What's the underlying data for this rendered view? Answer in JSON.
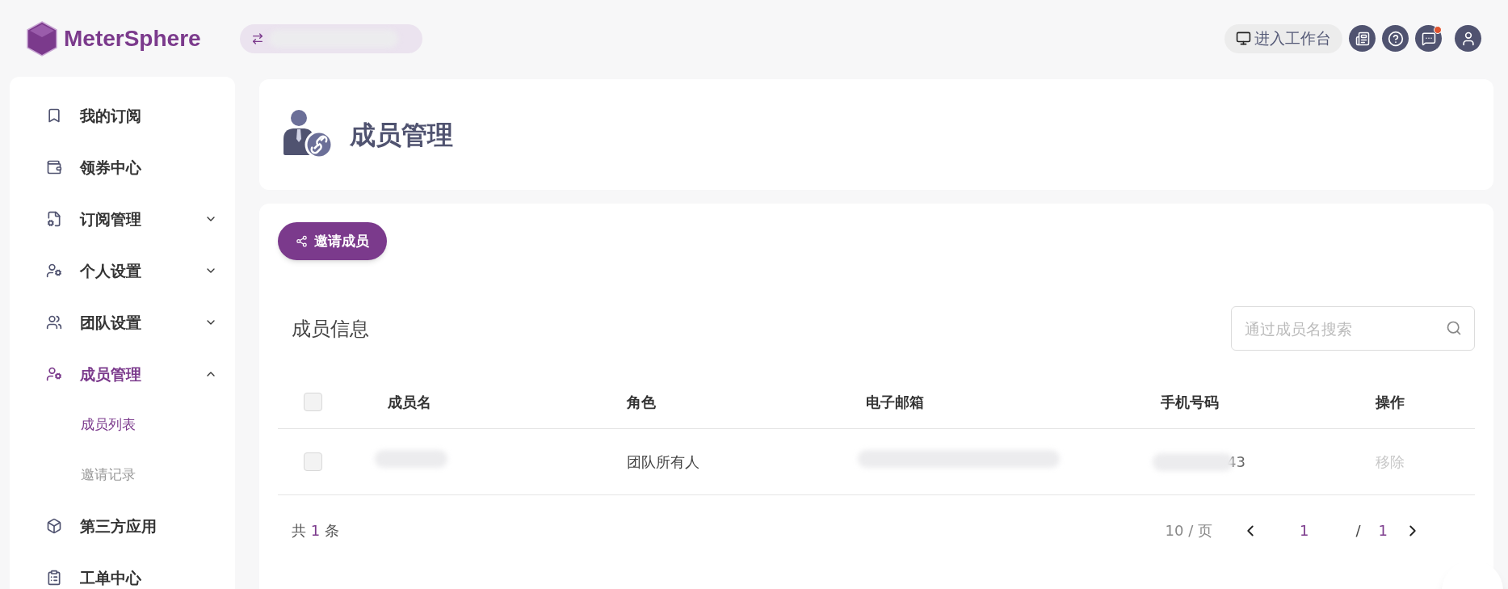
{
  "brand": {
    "name": "MeterSphere"
  },
  "header": {
    "workbench": "进入工作台",
    "message_badge": true
  },
  "sidebar": {
    "items": [
      {
        "kind": "item",
        "label": "我的订阅",
        "selected": false
      },
      {
        "kind": "item",
        "label": "领券中心",
        "selected": false
      },
      {
        "kind": "item",
        "label": "订阅管理",
        "selected": false,
        "expanded": false
      },
      {
        "kind": "item",
        "label": "个人设置",
        "selected": false,
        "expanded": false
      },
      {
        "kind": "item",
        "label": "团队设置",
        "selected": false,
        "expanded": false
      },
      {
        "kind": "item",
        "label": "成员管理",
        "selected": true,
        "expanded": true
      },
      {
        "kind": "sub",
        "label": "成员列表",
        "selected": true
      },
      {
        "kind": "sub",
        "label": "邀请记录",
        "selected": false
      },
      {
        "kind": "item",
        "label": "第三方应用",
        "selected": false
      },
      {
        "kind": "item",
        "label": "工单中心",
        "selected": false
      }
    ]
  },
  "page": {
    "title": "成员管理",
    "invite_button": "邀请成员",
    "section_title": "成员信息",
    "search": {
      "placeholder": "通过成员名搜索"
    }
  },
  "table": {
    "columns": [
      "成员名",
      "角色",
      "电子邮箱",
      "手机号码",
      "操作"
    ],
    "rows": [
      {
        "checked": false,
        "role": "团队所有人",
        "phone": "43",
        "action": "移除"
      }
    ],
    "header_checked": false
  },
  "pagination": {
    "total_prefix": "共",
    "total": "1",
    "total_suffix": "条",
    "page_size": "10 / 页",
    "current": "1",
    "separator": "/",
    "pages": "1"
  }
}
